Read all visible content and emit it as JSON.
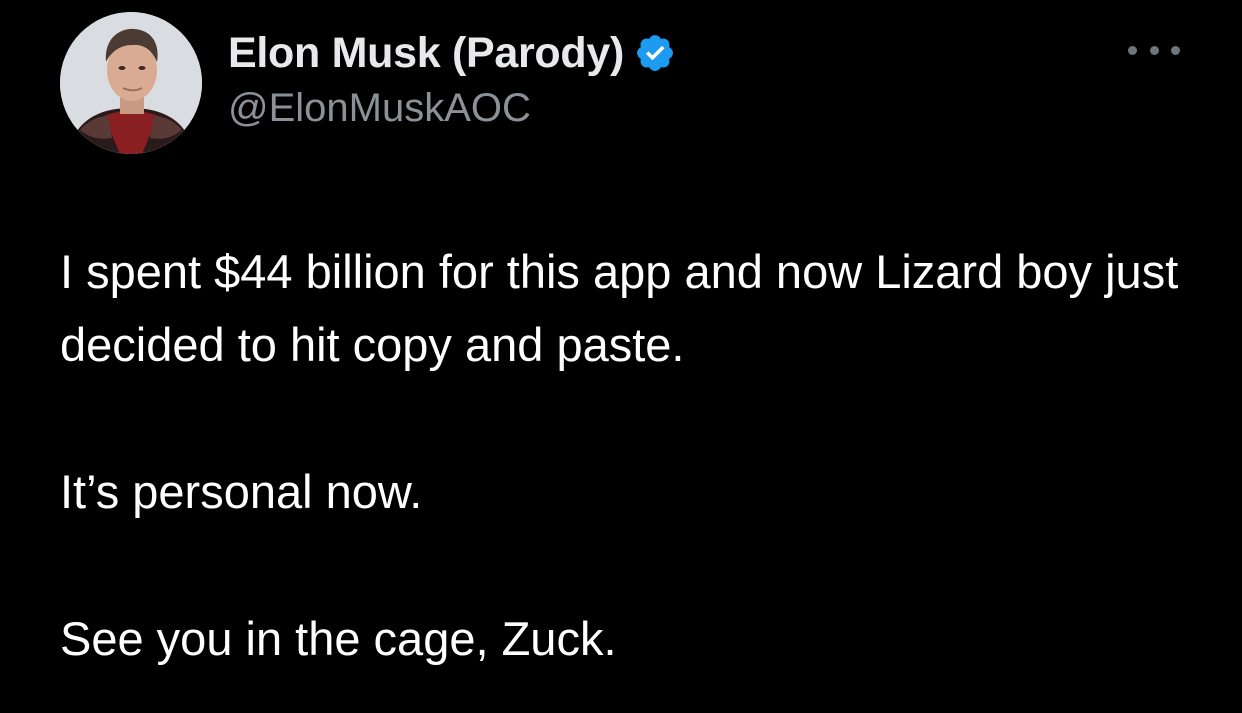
{
  "author": {
    "display_name": "Elon Musk (Parody)",
    "handle": "@ElonMuskAOC",
    "verified": true,
    "verified_color": "#1d9bf0"
  },
  "tweet": {
    "paragraphs": [
      "I spent $44 billion for this app and now Lizard boy just decided to hit copy and paste.",
      "It’s personal now.",
      "See you in the cage, Zuck."
    ]
  },
  "icons": {
    "more": "more-options-icon",
    "verified": "verified-badge-icon"
  },
  "colors": {
    "background": "#000000",
    "text": "#ffffff",
    "secondary_text": "#8b9196"
  }
}
